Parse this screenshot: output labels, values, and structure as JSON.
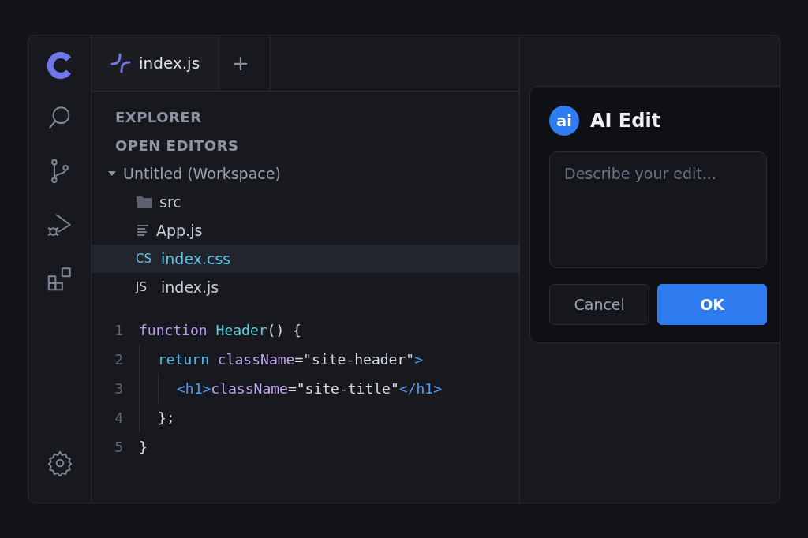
{
  "activity_bar": {
    "items": [
      {
        "kind": "search",
        "selected": false
      },
      {
        "kind": "branch",
        "selected": false
      },
      {
        "kind": "debug",
        "selected": false
      },
      {
        "kind": "extensions",
        "selected": false
      }
    ],
    "bottom": [
      {
        "kind": "settings",
        "selected": false
      }
    ]
  },
  "tabs": [
    {
      "label": "index.js",
      "selected": true
    }
  ],
  "tab_add": "+",
  "explorer": {
    "title": "EXPLORER",
    "section": "OPEN EDITORS",
    "tree": [
      {
        "label": "Untitled (Workspace)",
        "kind": "workspace",
        "expanded": true,
        "selected": false,
        "children": [
          {
            "label": "src",
            "kind": "folder",
            "selected": false
          },
          {
            "label": "App.js",
            "kind": "file",
            "selected": false
          },
          {
            "label": "index.css",
            "kind": "css",
            "badge": "CS",
            "selected": true
          },
          {
            "label": "index.js",
            "kind": "js",
            "badge": "JS",
            "selected": false
          }
        ]
      }
    ]
  },
  "code": {
    "lines": [
      {
        "number": "1",
        "tokens": [
          {
            "kind": "keyword",
            "text": "function "
          },
          {
            "kind": "func",
            "text": "Header"
          },
          {
            "kind": "plain",
            "text": "() {"
          }
        ],
        "children": [
          {
            "number": "2",
            "tokens": [
              {
                "kind": "ret",
                "text": "return "
              },
              {
                "kind": "attr",
                "text": "className"
              },
              {
                "kind": "plain",
                "text": "=\"site-header\""
              },
              {
                "kind": "tag",
                "text": ">"
              }
            ],
            "children": [
              {
                "number": "3",
                "tokens": [
                  {
                    "kind": "tag",
                    "text": "<h1>"
                  },
                  {
                    "kind": "attr",
                    "text": "className"
                  },
                  {
                    "kind": "plain",
                    "text": "=\"site-title\""
                  },
                  {
                    "kind": "tag",
                    "text": "</h1>"
                  }
                ]
              }
            ]
          },
          {
            "number": "4",
            "tokens": [
              {
                "kind": "plain",
                "text": "};"
              }
            ]
          }
        ]
      },
      {
        "number": "5",
        "tokens": [
          {
            "kind": "plain",
            "text": "}"
          }
        ]
      }
    ]
  },
  "ai_edit": {
    "badge": "ai",
    "title": "AI Edit",
    "placeholder": "Describe your edit...",
    "buttons": [
      {
        "label": "Cancel",
        "kind": "secondary"
      },
      {
        "label": "OK",
        "kind": "primary"
      }
    ]
  }
}
